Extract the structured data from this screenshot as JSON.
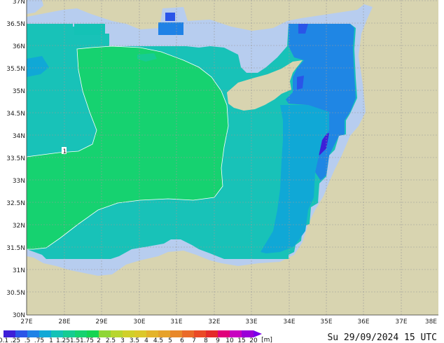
{
  "map": {
    "lat_ticks": [
      "37N",
      "36.5N",
      "36N",
      "35.5N",
      "35N",
      "34.5N",
      "34N",
      "33.5N",
      "33N",
      "32.5N",
      "32N",
      "31.5N",
      "31N",
      "30.5N",
      "30N"
    ],
    "lon_ticks": [
      "27E",
      "28E",
      "29E",
      "30E",
      "31E",
      "32E",
      "33E",
      "34E",
      "35E",
      "36E",
      "37E",
      "38E"
    ],
    "contour_label": "1",
    "colors": {
      "land": "#d8d4b0",
      "sea_fringe": "#b7cdef",
      "grid": "#9a9a9a"
    }
  },
  "colorbar": {
    "labels": [
      "0.1",
      ".25",
      ".5",
      ".75",
      "1",
      "1.25",
      "1.5",
      "1.75",
      "2",
      "2.5",
      "3",
      "3.5",
      "4",
      "4.5",
      "5",
      "6",
      "7",
      "8",
      "9",
      "10",
      "15",
      "20"
    ],
    "unit": "[m]",
    "colors": [
      "#3d1fd8",
      "#2a55e8",
      "#1f82e6",
      "#10a8d6",
      "#14c2b6",
      "#16cc92",
      "#16d270",
      "#14d452",
      "#8fd636",
      "#b8d62e",
      "#d0d02a",
      "#dcc82a",
      "#e4b42a",
      "#e6a22a",
      "#e8882a",
      "#ea6a28",
      "#ea4a26",
      "#e42a2a",
      "#e0007a",
      "#c800c0",
      "#9a00d8",
      "#7a00e8"
    ]
  },
  "timestamp": "Su 29/09/2024 15 UTC"
}
